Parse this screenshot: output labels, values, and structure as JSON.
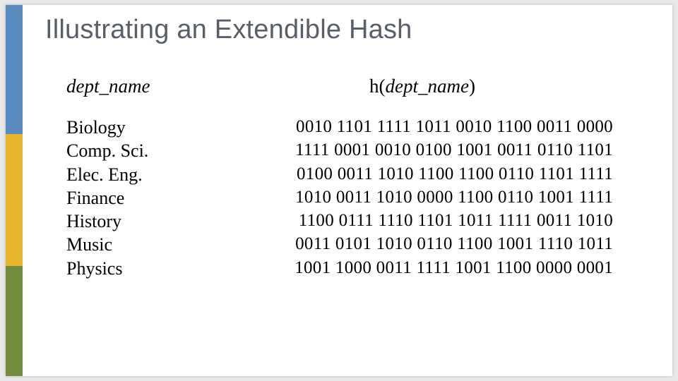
{
  "title": "Illustrating an Extendible Hash",
  "headers": {
    "dept": "dept_name",
    "hash_fn": "h",
    "hash_open": "(",
    "hash_arg": "dept_name",
    "hash_close": ")"
  },
  "rows": [
    {
      "dept": "Biology",
      "hash": "0010 1101 1111 1011 0010 1100 0011 0000"
    },
    {
      "dept": "Comp. Sci.",
      "hash": "1111 0001 0010 0100 1001 0011 0110 1101"
    },
    {
      "dept": "Elec. Eng.",
      "hash": "0100 0011 1010 1100 1100 0110 1101 1111"
    },
    {
      "dept": "Finance",
      "hash": "1010 0011 1010 0000 1100 0110 1001 1111"
    },
    {
      "dept": "History",
      "hash": "1100 0111 1110 1101 1011 1111 0011 1010"
    },
    {
      "dept": "Music",
      "hash": "0011 0101 1010 0110 1100 1001 1110 1011"
    },
    {
      "dept": "Physics",
      "hash": "1001 1000 0011 1111 1001 1100 0000 0001"
    }
  ]
}
